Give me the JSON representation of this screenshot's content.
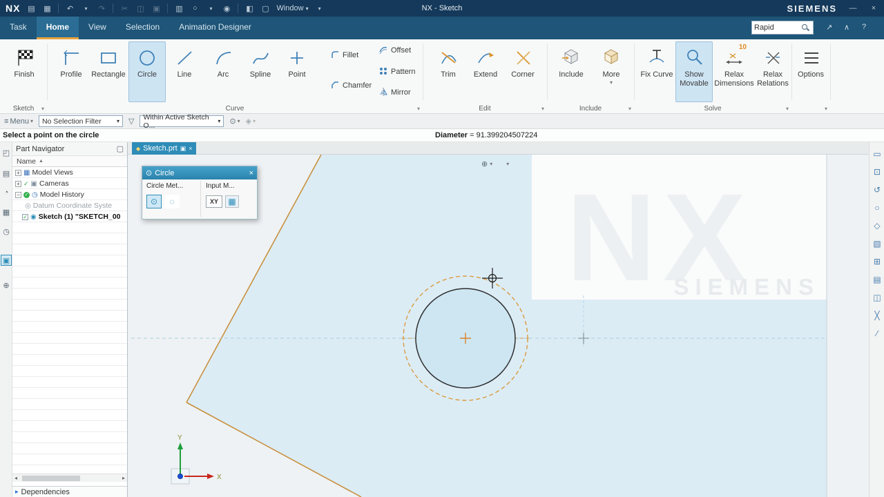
{
  "glyphs": {
    "dropdown": "▾",
    "menu": "≡",
    "expand": "+",
    "collapse": "−",
    "close": "×",
    "minimize": "—",
    "check": "✓",
    "sort_asc": "▲",
    "scroll_left": "◂",
    "scroll_right": "▸",
    "dep_arrow": "▸",
    "help": "?",
    "fullscreen": "↗",
    "ribbon_collapse": "∧",
    "pin": "▣",
    "diamond": "◆"
  },
  "icons": {
    "save": "▤",
    "open": "▦",
    "undo": "↶",
    "redo": "↷",
    "cut": "✂",
    "copy": "◫",
    "paste": "▣",
    "print": "▥",
    "circle_tool": "○",
    "touch": "◉",
    "win_split": "◧",
    "win_new": "▢",
    "funnel": "▽",
    "snap": "⊙",
    "snap2": "◈",
    "view_orient": "⊕",
    "panel": "▢",
    "dlg_title": "⊙",
    "dlg_circle1": "⊙",
    "dlg_circle2": "◌",
    "dlg_grid": "▦"
  },
  "left_strip": {
    "items": [
      "◰",
      "▤",
      "◔",
      "▦",
      "◷",
      "▣",
      "⊕"
    ]
  },
  "right_strip": {
    "items": [
      "▭",
      "⊡",
      "↺",
      "○",
      "◇",
      "▧",
      "⊞",
      "▤",
      "◫",
      "╳",
      "∕"
    ]
  },
  "titlebar": {
    "logo": "NX",
    "title": "NX - Sketch",
    "brand": "SIEMENS",
    "window_label": "Window"
  },
  "tabs": {
    "task": "Task",
    "home": "Home",
    "view": "View",
    "selection": "Selection",
    "animation": "Animation Designer",
    "search_value": "Rapid"
  },
  "ribbon": {
    "finish": "Finish",
    "profile": "Profile",
    "rectangle": "Rectangle",
    "circle": "Circle",
    "line": "Line",
    "arc": "Arc",
    "spline": "Spline",
    "point": "Point",
    "fillet": "Fillet",
    "chamfer": "Chamfer",
    "offset": "Offset",
    "pattern": "Pattern",
    "mirror": "Mirror",
    "trim": "Trim",
    "extend": "Extend",
    "corner": "Corner",
    "include": "Include",
    "more": "More",
    "fix_curve": "Fix Curve",
    "show_movable": "Show Movable",
    "relax_dimensions": "Relax Dimensions",
    "relax_relations": "Relax Relations",
    "relax_badge": "10",
    "options": "Options"
  },
  "groups": {
    "sketch": "Sketch",
    "curve": "Curve",
    "edit": "Edit",
    "include": "Include",
    "solve": "Solve"
  },
  "filterbar": {
    "menu": "Menu",
    "selection_filter": "No Selection Filter",
    "scope": "Within Active Sketch O..."
  },
  "prompt": {
    "cue": "Select a point on the circle",
    "dim_label": "Diameter",
    "equals": "=",
    "dim_value": "91.399204507224"
  },
  "part_navigator": {
    "title": "Part Navigator",
    "column": "Name",
    "rows": [
      {
        "label": "Model Views"
      },
      {
        "label": "Cameras"
      },
      {
        "label": "Model History"
      },
      {
        "label": "Datum Coordinate Syste"
      },
      {
        "label": "Sketch (1) \"SKETCH_00"
      }
    ],
    "dependencies": "Dependencies"
  },
  "doc_tab": {
    "label": "Sketch.prt"
  },
  "dialog": {
    "title": "Circle",
    "method_label": "Circle Met...",
    "input_label": "Input M...",
    "xy": "XY"
  },
  "canvas": {
    "watermark_top": "NX",
    "watermark_bottom": "SIEMENS",
    "axis_x": "X",
    "axis_y": "Y"
  }
}
